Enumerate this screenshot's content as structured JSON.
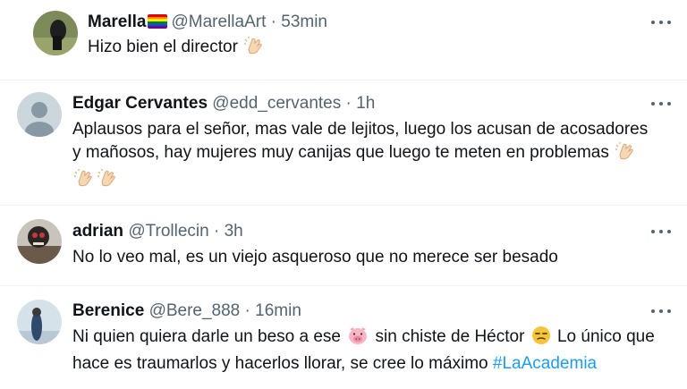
{
  "tweets": [
    {
      "name": "Marella",
      "handle": "@MarellaArt",
      "separator": "·",
      "time": "53min",
      "badge": "rainbow-flag",
      "lines": [
        "Hizo bien el director"
      ],
      "emoji": [
        "clapping-hands"
      ]
    },
    {
      "name": "Edgar Cervantes",
      "handle": "@edd_cervantes",
      "separator": "·",
      "time": "1h",
      "lines": [
        "Aplausos para el señor, mas vale de lejitos, luego los acusan de acosadores",
        "y mañosos, hay mujeres muy canijas que luego te meten en problemas"
      ],
      "emoji": [
        "clapping-hands",
        "clapping-hands",
        "clapping-hands"
      ]
    },
    {
      "name": "adrian",
      "handle": "@Trollecin",
      "separator": "·",
      "time": "3h",
      "lines": [
        "No lo veo mal, es un viejo asqueroso que no merece ser besado"
      ]
    },
    {
      "name": "Berenice",
      "handle": "@Bere_888",
      "separator": "·",
      "time": "16min",
      "line1_a": "Ni quien quiera darle un beso a ese",
      "line1_b": "sin chiste de Héctor",
      "line1_c": "Lo único que",
      "line2": "hace es traumarlos y hacerlos llorar, se cree lo máximo",
      "hashtag": "#LaAcademia",
      "emoji": [
        "pig-face",
        "unamused-face"
      ]
    }
  ],
  "colors": {
    "text": "#0f1419",
    "secondary": "#536471",
    "link": "#1d9bf0",
    "divider": "#eff3f4"
  },
  "icons": {
    "more": "more-dots-icon",
    "default_avatar": "default-avatar-icon"
  }
}
